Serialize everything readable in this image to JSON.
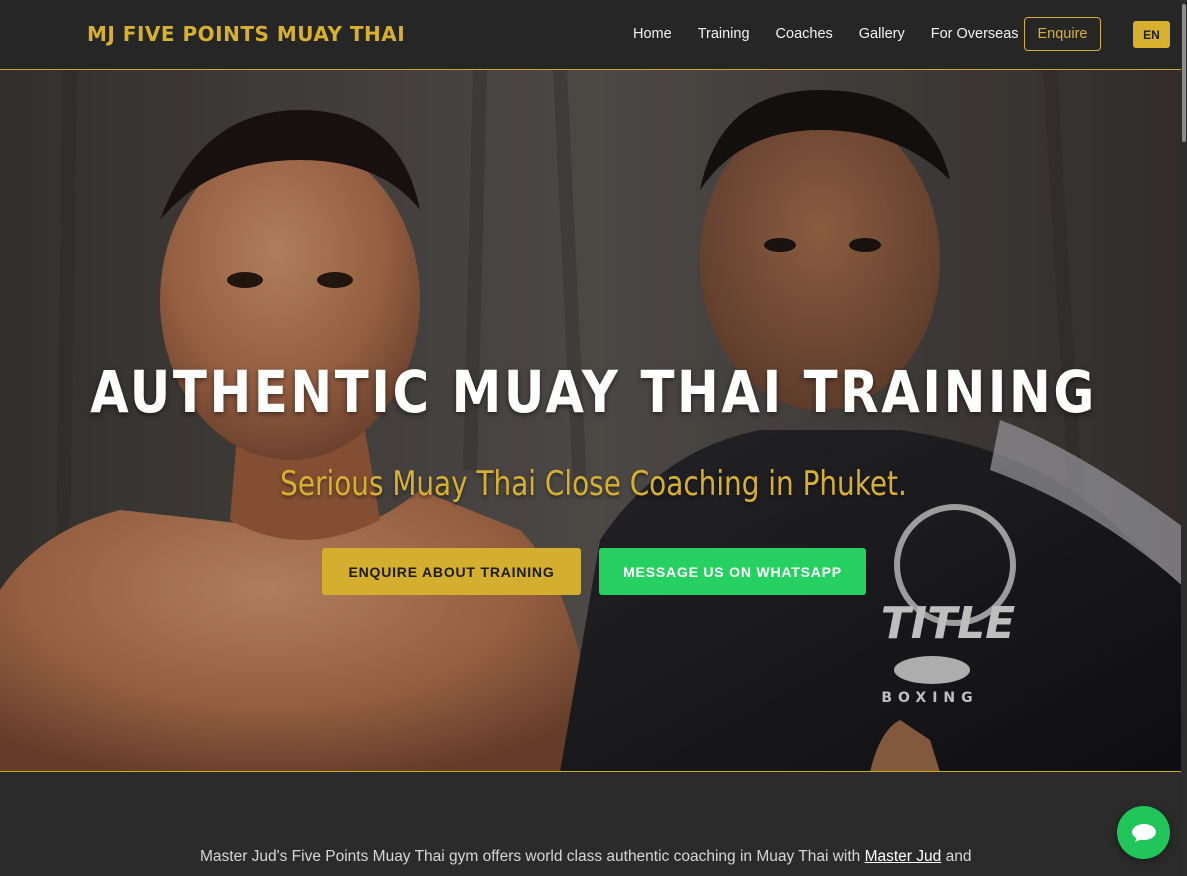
{
  "header": {
    "brand": "MJ FIVE POINTS MUAY THAI",
    "nav": [
      "Home",
      "Training",
      "Coaches",
      "Gallery",
      "For Overseas"
    ],
    "enquire_label": "Enquire",
    "lang_label": "EN"
  },
  "hero": {
    "title": "AUTHENTIC MUAY THAI TRAINING",
    "subtitle": "Serious Muay Thai Close Coaching in Phuket.",
    "enquire_button": "ENQUIRE ABOUT TRAINING",
    "whatsapp_button": "MESSAGE US ON WHATSAPP",
    "jacket_text": "TITLE",
    "jacket_subtext": "BOXING"
  },
  "intro": {
    "text_before": "Master Jud's Five Points Muay Thai gym offers world class authentic coaching in Muay Thai with ",
    "link_text": "Master Jud",
    "text_after": " and"
  },
  "colors": {
    "accent_gold": "#d8b030",
    "whatsapp_green": "#27d062",
    "nav_bg": "#262626"
  },
  "icons": {
    "chat": "chat-bubble-icon"
  }
}
